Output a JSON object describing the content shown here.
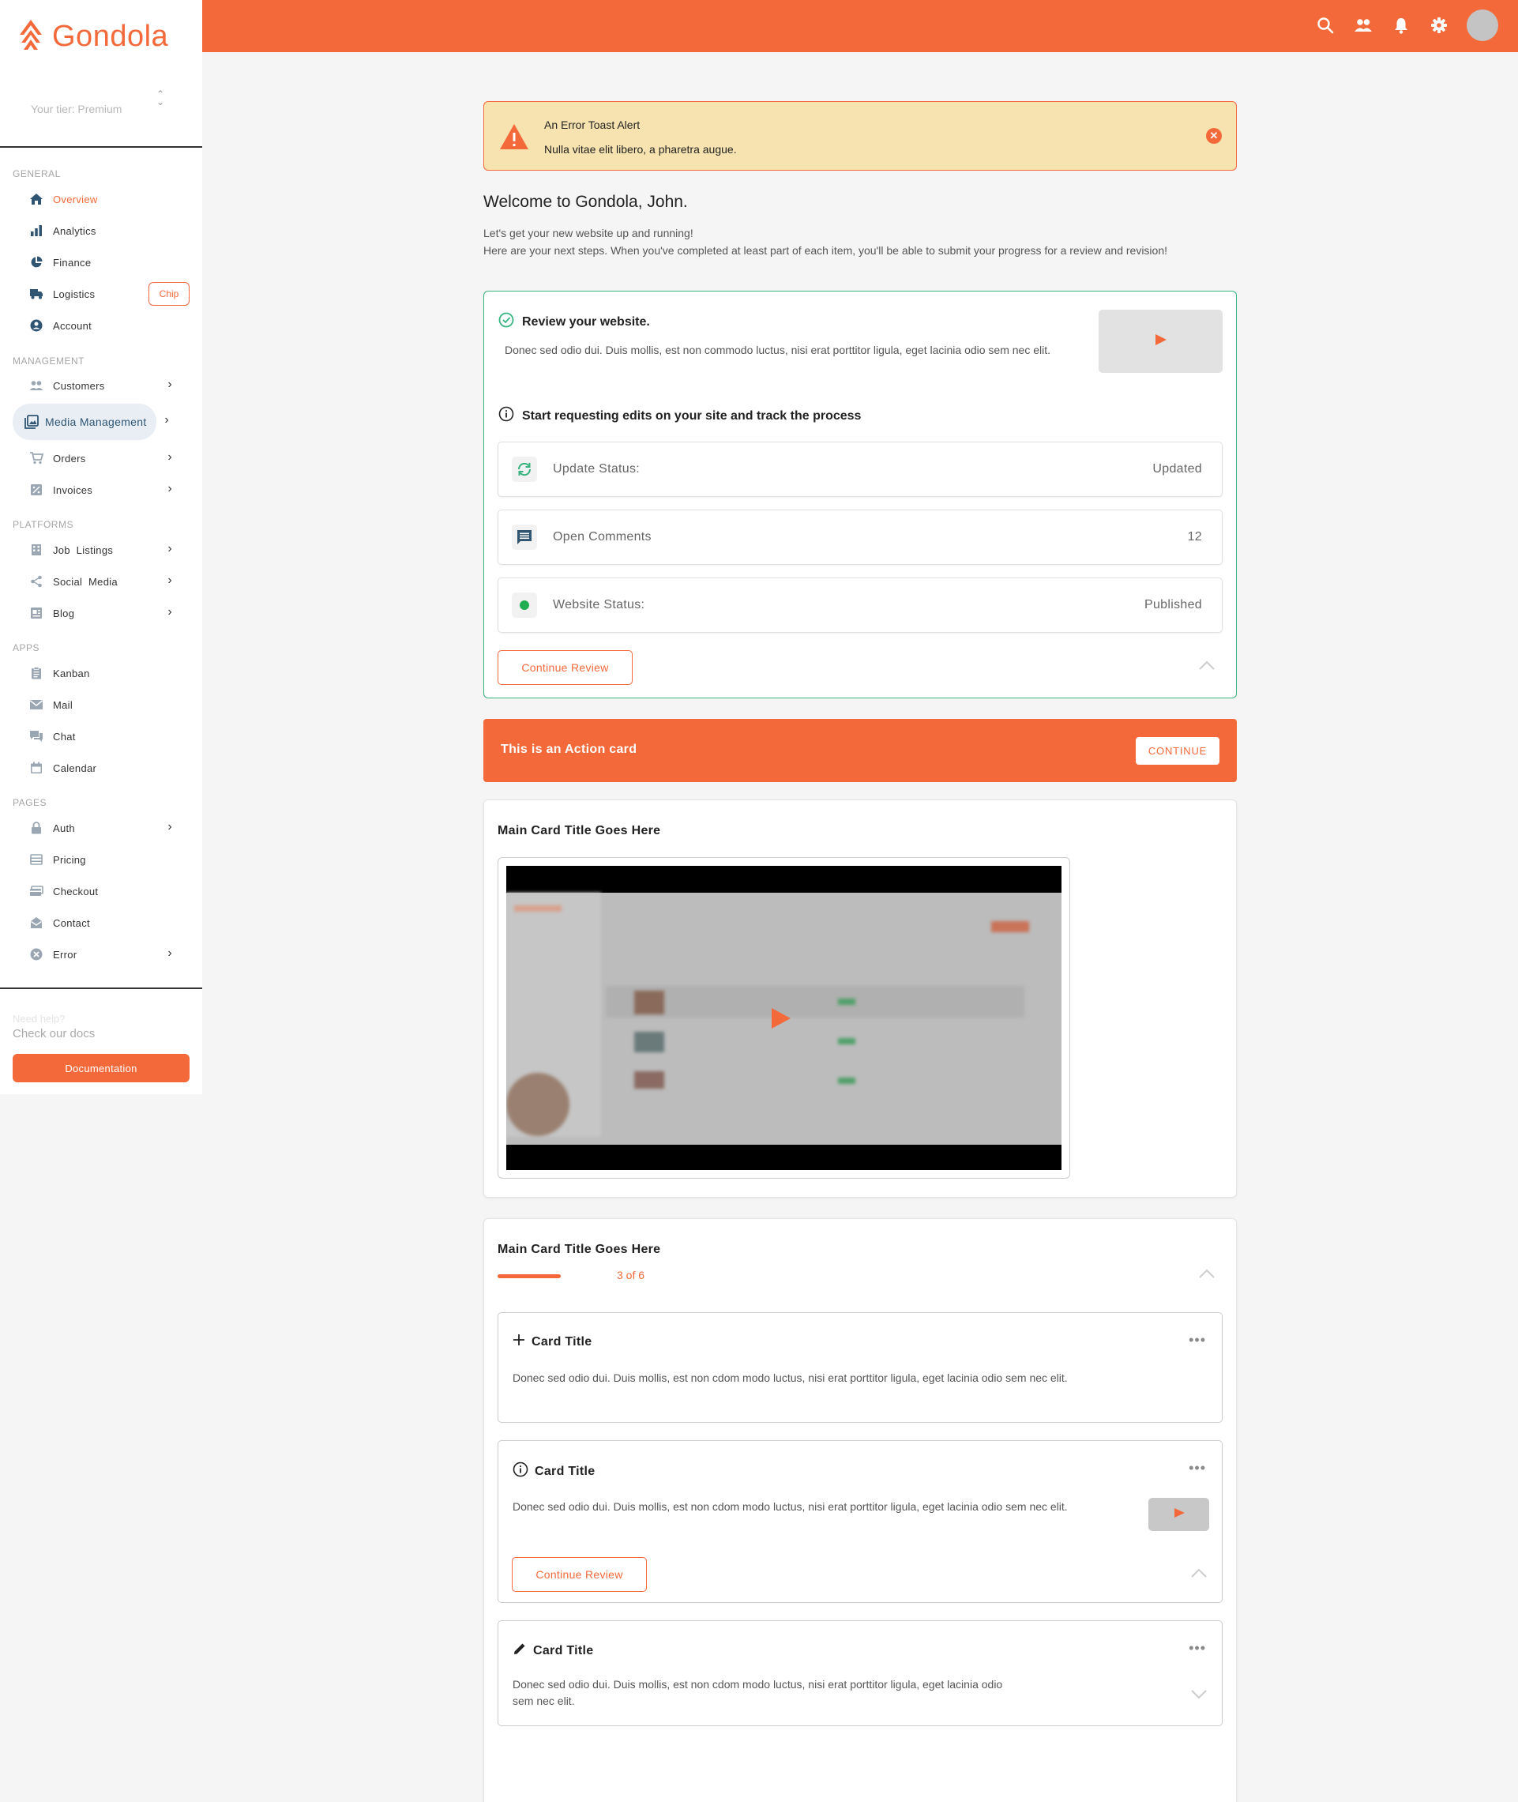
{
  "brand": {
    "name": "Gondola",
    "color": "#f4693a"
  },
  "tier": {
    "label": "Your tier: Premium"
  },
  "sidebar": {
    "sections": {
      "general": "GENERAL",
      "management": "MANAGEMENT",
      "platforms": "PLATFORMS",
      "apps": "APPS",
      "pages": "PAGES"
    },
    "items": {
      "overview": "Overview",
      "analytics": "Analytics",
      "finance": "Finance",
      "logistics": "Logistics",
      "account": "Account",
      "customers": "Customers",
      "media": "Media Management",
      "orders": "Orders",
      "invoices": "Invoices",
      "jobs": "Job  Listings",
      "social": "Social  Media",
      "blog": "Blog",
      "kanban": "Kanban",
      "mail": "Mail",
      "chat": "Chat",
      "calendar": "Calendar",
      "auth": "Auth",
      "pricing": "Pricing",
      "checkout": "Checkout",
      "contact": "Contact",
      "error": "Error"
    },
    "chip": "Chip",
    "help": {
      "question": "Need help?",
      "docs": "Check our docs",
      "button": "Documentation"
    }
  },
  "topbar": {
    "icons": [
      "search-icon",
      "people-icon",
      "bell-icon",
      "settings-icon",
      "avatar"
    ]
  },
  "alert": {
    "title": "An Error Toast Alert",
    "text": "Nulla vitae elit libero, a pharetra augue."
  },
  "welcome": {
    "title": "Welcome to Gondola, John.",
    "line1": "Let's get your new website up and running!",
    "line2": "Here are your next steps. When you've completed at least part of each item, you'll be able to submit your progress for a review and revision!"
  },
  "review": {
    "title": "Review your website.",
    "desc": "Donec sed odio dui. Duis mollis, est non commodo luctus, nisi erat porttitor ligula, eget lacinia odio sem nec elit.",
    "subtitle": "Start requesting edits on your site and track the process",
    "rows": [
      {
        "label": "Update Status:",
        "value": "Updated"
      },
      {
        "label": "Open Comments",
        "value": "12"
      },
      {
        "label": "Website Status:",
        "value": "Published"
      }
    ],
    "button": "Continue Review"
  },
  "action": {
    "text": "This is an Action card",
    "button": "CONTINUE"
  },
  "card1": {
    "title": "Main Card Title Goes Here"
  },
  "card2": {
    "title": "Main Card Title Goes Here",
    "progress": {
      "label": "3 of 6",
      "value": 0.5
    },
    "items": [
      {
        "title": "Card Title",
        "desc": "Donec sed odio dui. Duis mollis, est non cdom modo luctus, nisi erat porttitor ligula, eget lacinia odio sem nec elit."
      },
      {
        "title": "Card Title",
        "desc": "Donec sed odio dui. Duis mollis, est non cdom modo luctus, nisi erat porttitor ligula, eget lacinia odio sem nec elit.",
        "button": "Continue Review"
      },
      {
        "title": "Card Title",
        "desc": "Donec sed odio dui. Duis mollis, est non cdom modo luctus, nisi erat porttitor ligula, eget lacinia odio sem nec elit."
      }
    ]
  }
}
